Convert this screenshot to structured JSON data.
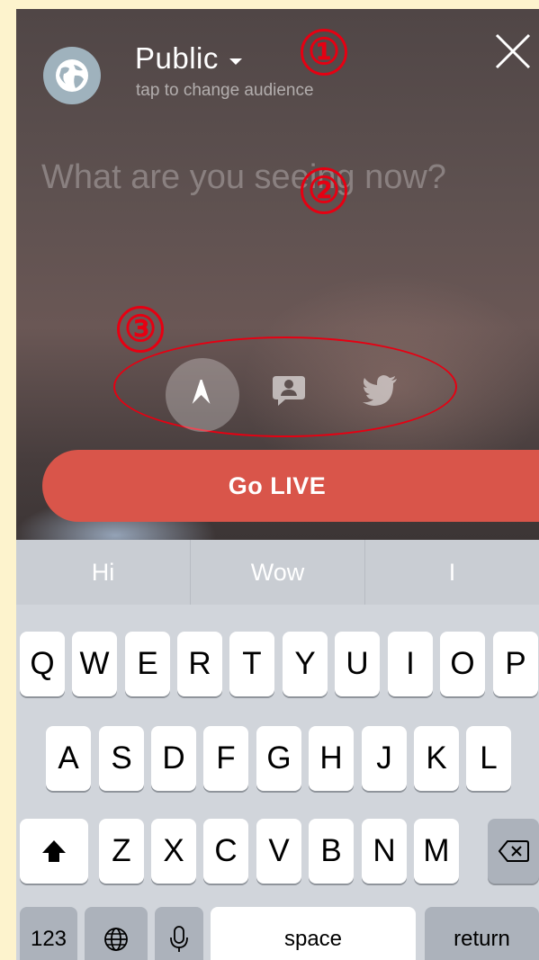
{
  "audience": {
    "title": "Public",
    "subtitle": "tap to change audience"
  },
  "composer": {
    "placeholder": "What are you seeing now?"
  },
  "annotations": [
    "①",
    "②",
    "③"
  ],
  "share_options": [
    {
      "icon": "location-arrow-icon",
      "active": true
    },
    {
      "icon": "private-chat-icon",
      "active": false
    },
    {
      "icon": "twitter-icon",
      "active": false
    }
  ],
  "go_live_label": "Go LIVE",
  "keyboard": {
    "suggestions": [
      "Hi",
      "Wow",
      "I"
    ],
    "row1": [
      "Q",
      "W",
      "E",
      "R",
      "T",
      "Y",
      "U",
      "I",
      "O",
      "P"
    ],
    "row2": [
      "A",
      "S",
      "D",
      "F",
      "G",
      "H",
      "J",
      "K",
      "L"
    ],
    "row3": [
      "Z",
      "X",
      "C",
      "V",
      "B",
      "N",
      "M"
    ],
    "numbers_label": "123",
    "space_label": "space",
    "return_label": "return"
  },
  "colors": {
    "accent": "#d9554a",
    "annotation": "#e60012",
    "frame": "#fdf3cd"
  }
}
